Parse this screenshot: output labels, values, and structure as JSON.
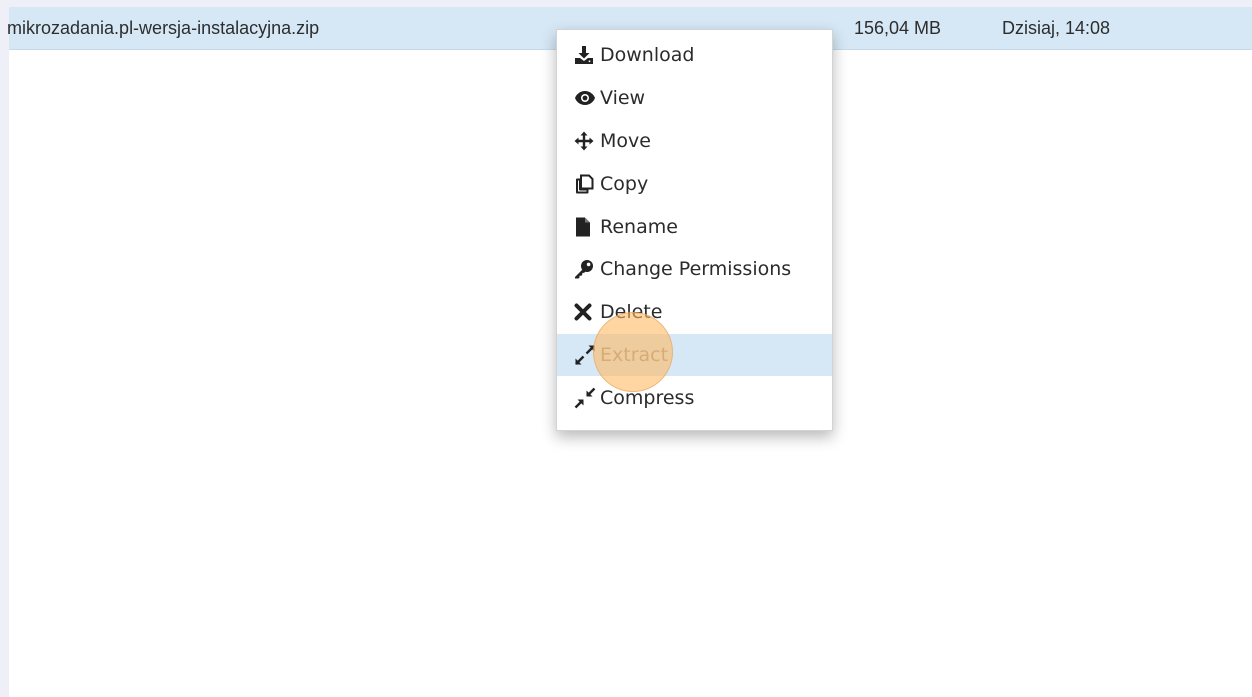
{
  "file_row": {
    "name": "mikrozadania.pl-wersja-instalacyjna.zip",
    "size": "156,04 MB",
    "modified": "Dzisiaj, 14:08"
  },
  "context_menu": {
    "items": [
      {
        "label": "Download",
        "icon": "download-icon"
      },
      {
        "label": "View",
        "icon": "eye-icon"
      },
      {
        "label": "Move",
        "icon": "move-arrows-icon"
      },
      {
        "label": "Copy",
        "icon": "copy-icon"
      },
      {
        "label": "Rename",
        "icon": "file-icon"
      },
      {
        "label": "Change Permissions",
        "icon": "key-icon"
      },
      {
        "label": "Delete",
        "icon": "x-icon"
      },
      {
        "label": "Extract",
        "icon": "expand-arrows-icon",
        "state": "hovered"
      },
      {
        "label": "Compress",
        "icon": "compress-arrows-icon"
      }
    ]
  },
  "colors": {
    "row_selected": "#d6e8f6",
    "menu_hover": "#d6e8f6",
    "click_indicator": "#ffb85e",
    "page_edge": "#eeeff7"
  }
}
